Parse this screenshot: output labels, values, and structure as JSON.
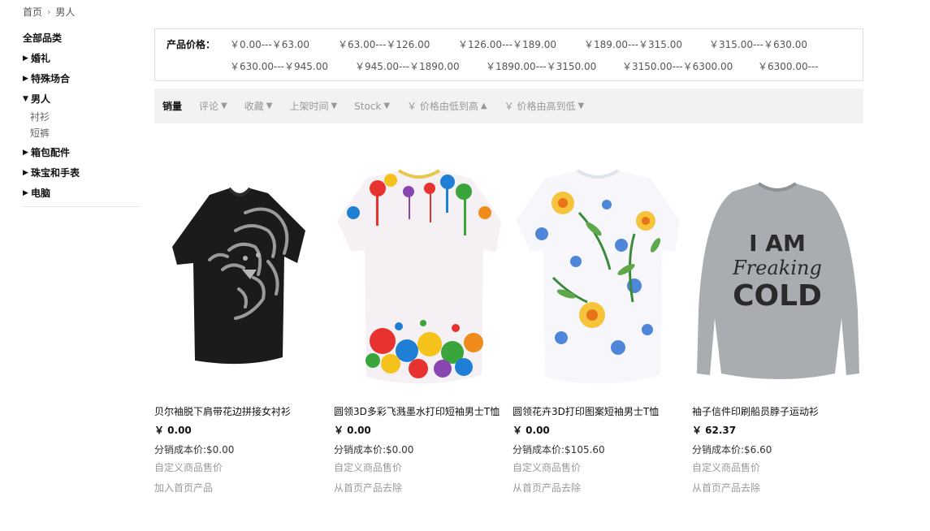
{
  "breadcrumb": {
    "home": "首页",
    "current": "男人"
  },
  "sidebar": {
    "all_label": "全部品类",
    "categories": [
      {
        "label": "婚礼"
      },
      {
        "label": "特殊场合"
      },
      {
        "label": "男人",
        "children": [
          "衬衫",
          "短裤"
        ]
      },
      {
        "label": "箱包配件"
      },
      {
        "label": "珠宝和手表"
      },
      {
        "label": "电脑"
      }
    ]
  },
  "price_filter": {
    "label": "产品价格：",
    "ranges": [
      "￥0.00---￥63.00",
      "￥63.00---￥126.00",
      "￥126.00---￥189.00",
      "￥189.00---￥315.00",
      "￥315.00---￥630.00",
      "￥630.00---￥945.00",
      "￥945.00---￥1890.00",
      "￥1890.00---￥3150.00",
      "￥3150.00---￥6300.00",
      "￥6300.00---"
    ]
  },
  "sort": {
    "items": [
      "销量",
      "评论",
      "收藏",
      "上架时间",
      "Stock",
      "￥ 价格由低到高",
      "￥ 价格由高到低"
    ]
  },
  "products": [
    {
      "name": "贝尔袖脱下肩带花边拼接女衬衫",
      "price": "￥ 0.00",
      "cost": "分销成本价:$0.00",
      "custom_price": "自定义商品售价",
      "home_action": "加入首页产品",
      "image": "black-lion-tshirt"
    },
    {
      "name": "圆领3D多彩飞溅墨水打印短袖男士T恤",
      "price": "￥ 0.00",
      "cost": "分销成本价:$0.00",
      "custom_price": "自定义商品售价",
      "home_action": "从首页产品去除",
      "image": "paint-splash-tshirt"
    },
    {
      "name": "圆领花卉3D打印图案短袖男士T恤",
      "price": "￥ 0.00",
      "cost": "分销成本价:$105.60",
      "custom_price": "自定义商品售价",
      "home_action": "从首页产品去除",
      "image": "floral-tshirt"
    },
    {
      "name": "袖子信件印刷船员脖子运动衫",
      "price": "￥ 62.37",
      "cost": "分销成本价:$6.60",
      "custom_price": "自定义商品售价",
      "home_action": "从首页产品去除",
      "image": "grey-sweatshirt",
      "print_line1": "I AM",
      "print_line2": "Freaking",
      "print_line3": "COLD"
    }
  ]
}
